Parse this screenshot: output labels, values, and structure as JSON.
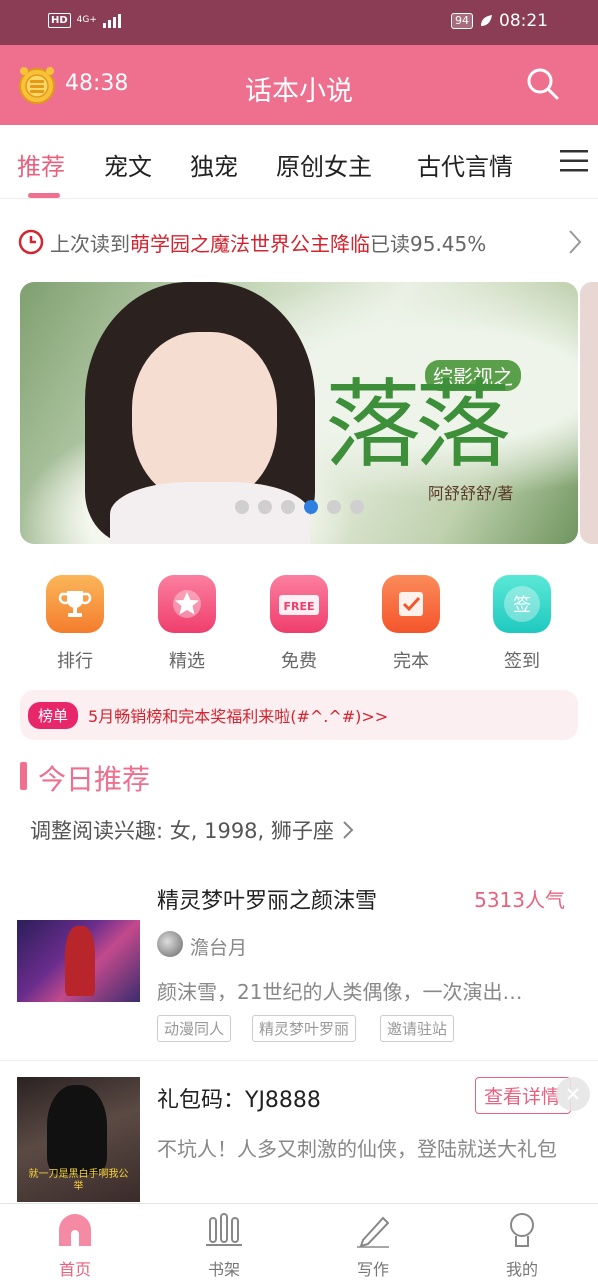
{
  "status_bar": {
    "hd": "HD",
    "network": "4G+",
    "battery": "94",
    "time": "08:21"
  },
  "header": {
    "timer": "48:38",
    "title": "话本小说"
  },
  "tabs": [
    {
      "label": "推荐",
      "active": true
    },
    {
      "label": "宠文"
    },
    {
      "label": "独宠"
    },
    {
      "label": "原创女主"
    },
    {
      "label": "古代言情"
    }
  ],
  "last_read": {
    "prefix": "上次读到",
    "book": "萌学园之魔法世界公主降临",
    "progress": "已读95.45%"
  },
  "banner": {
    "subtitle": "综影视之",
    "title": "落落",
    "author": "阿舒舒舒/著",
    "dot_count": 6,
    "active_dot": 4
  },
  "quick_nav": [
    {
      "label": "排行",
      "icon": "trophy-icon",
      "color": "#f6903a"
    },
    {
      "label": "精选",
      "icon": "star-icon",
      "color": "#f0537a"
    },
    {
      "label": "免费",
      "icon": "free-tag-icon",
      "color": "#f0537a"
    },
    {
      "label": "完本",
      "icon": "check-box-icon",
      "color": "#f7693e"
    },
    {
      "label": "签到",
      "icon": "sign-in-icon",
      "color": "#2ed6c9",
      "glyph": "签"
    }
  ],
  "notice": {
    "badge": "榜单",
    "text": "5月畅销榜和完本奖福利来啦(#^.^#)>>"
  },
  "section": {
    "title": "今日推荐",
    "interest": "调整阅读兴趣: 女, 1998, 狮子座"
  },
  "books": [
    {
      "title": "精灵梦叶罗丽之颜沫雪",
      "popularity": "5313人气",
      "author": "澹台月",
      "desc": "颜沫雪，21世纪的人类偶像，一次演出…",
      "tags": [
        "动漫同人",
        "精灵梦叶罗丽",
        "邀请驻站"
      ]
    }
  ],
  "ad": {
    "title": "礼包码：YJ8888",
    "button": "查看详情",
    "desc": "不坑人！人多又刺激的仙侠，登陆就送大礼包",
    "cover_caption": "就一刀是黑白手啊我公举"
  },
  "bottom_nav": [
    {
      "label": "首页",
      "icon": "home-icon",
      "active": true
    },
    {
      "label": "书架",
      "icon": "bookshelf-icon"
    },
    {
      "label": "写作",
      "icon": "pen-icon"
    },
    {
      "label": "我的",
      "icon": "profile-icon"
    }
  ],
  "colors": {
    "accent": "#ef6f8e",
    "status_bar": "#8a3d55",
    "highlight_red": "#d4242f",
    "dot_active": "#2f7fe0"
  }
}
